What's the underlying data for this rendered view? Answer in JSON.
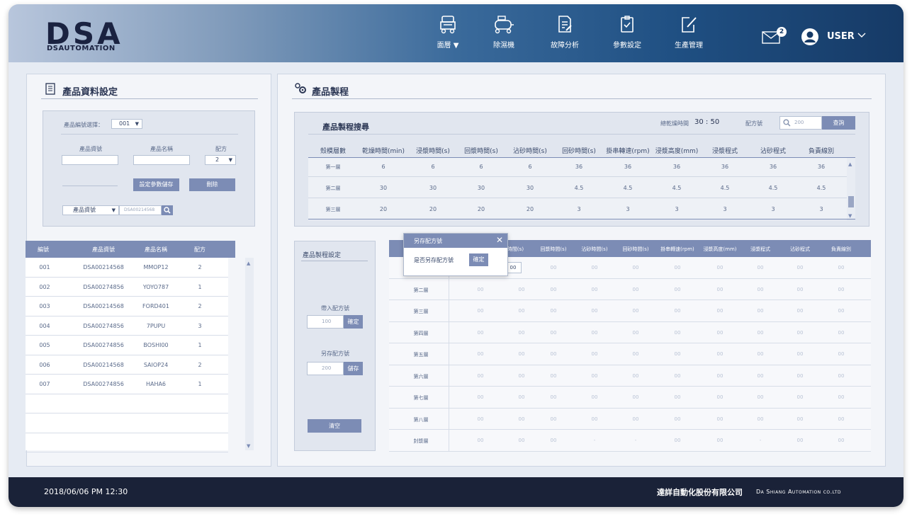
{
  "header": {
    "logo_text": "DSA",
    "logo_sub": "DSAUTOMATION",
    "nav": [
      {
        "label": "面層 ▼",
        "icon": "machine-icon"
      },
      {
        "label": "除濕機",
        "icon": "dehumidifier-icon"
      },
      {
        "label": "故障分析",
        "icon": "document-edit-icon"
      },
      {
        "label": "參數設定",
        "icon": "clipboard-check-icon"
      },
      {
        "label": "生產管理",
        "icon": "pencil-square-icon"
      }
    ],
    "mail_badge": "2",
    "user_label": "USER"
  },
  "left_panel": {
    "title": "產品資料設定",
    "product_select_label": "產品編號選擇：",
    "product_select_value": "001",
    "fields": {
      "material_label": "產品資號",
      "name_label": "產品名稱",
      "recipe_label": "配方",
      "recipe_value": "2"
    },
    "save_button": "設定參數儲存",
    "delete_button": "刪除",
    "search_select": "產品資號",
    "search_placeholder": "DSA00214568",
    "table": {
      "headers": [
        "編號",
        "產品資號",
        "產品名稱",
        "配方"
      ],
      "rows": [
        [
          "001",
          "DSA00214568",
          "MMOP12",
          "2"
        ],
        [
          "002",
          "DSA00274856",
          "YOYO787",
          "1"
        ],
        [
          "003",
          "DSA00214568",
          "FORD401",
          "2"
        ],
        [
          "004",
          "DSA00274856",
          "7PUPU",
          "3"
        ],
        [
          "005",
          "DSA00274856",
          "BOSHI00",
          "1"
        ],
        [
          "006",
          "DSA00214568",
          "SAIOP24",
          "2"
        ],
        [
          "007",
          "DSA00274856",
          "HAHA6",
          "1"
        ]
      ]
    }
  },
  "right_panel": {
    "title": "產品製程",
    "search": {
      "title": "產品製程搜尋",
      "total_time_label": "總乾燥時間",
      "total_time_value": "30 : 50",
      "recipe_label": "配方號",
      "recipe_placeholder": "200",
      "query_button": "查詢",
      "headers": [
        "殼模層數",
        "乾燥時間(min)",
        "浸漿時間(s)",
        "回漿時間(s)",
        "沾砂時間(s)",
        "回砂時間(s)",
        "掛串轉速(rpm)",
        "浸漿高度(mm)",
        "浸漿程式",
        "沾砂程式",
        "負責線別"
      ],
      "rows": [
        [
          "第一層",
          "6",
          "6",
          "6",
          "6",
          "36",
          "36",
          "36",
          "36",
          "36",
          "36"
        ],
        [
          "第二層",
          "30",
          "30",
          "30",
          "30",
          "4.5",
          "4.5",
          "4.5",
          "4.5",
          "4.5",
          "4.5"
        ],
        [
          "第三層",
          "20",
          "20",
          "20",
          "20",
          "3",
          "3",
          "3",
          "3",
          "3",
          "3"
        ]
      ]
    },
    "settings": {
      "title": "產品製程設定",
      "load_label": "帶入配方號",
      "load_value": "100",
      "load_button": "確定",
      "save_label": "另存配方號",
      "save_value": "200",
      "save_button": "儲存",
      "clear_button": "清空"
    },
    "grid": {
      "headers": [
        "",
        "",
        "燥時間(s)",
        "回漿時間(s)",
        "沾砂時間(s)",
        "回砂時間(s)",
        "掛串轉速(rpm)",
        "浸漿高度(mm)",
        "浸漿程式",
        "沾砂程式",
        "負責線別"
      ],
      "first_row_value": "00",
      "rows": [
        {
          "label": "",
          "vals": [
            "00",
            "00",
            "00",
            "00",
            "00",
            "00",
            "00",
            "00",
            "00"
          ]
        },
        {
          "label": "第二層",
          "vals": [
            "00",
            "00",
            "00",
            "00",
            "00",
            "00",
            "00",
            "00",
            "00",
            "00"
          ]
        },
        {
          "label": "第三層",
          "vals": [
            "00",
            "00",
            "00",
            "00",
            "00",
            "00",
            "00",
            "00",
            "00",
            "00"
          ]
        },
        {
          "label": "第四層",
          "vals": [
            "00",
            "00",
            "00",
            "00",
            "00",
            "00",
            "00",
            "00",
            "00",
            "00"
          ]
        },
        {
          "label": "第五層",
          "vals": [
            "00",
            "00",
            "00",
            "00",
            "00",
            "00",
            "00",
            "00",
            "00",
            "00"
          ]
        },
        {
          "label": "第六層",
          "vals": [
            "00",
            "00",
            "00",
            "00",
            "00",
            "00",
            "00",
            "00",
            "00",
            "00"
          ]
        },
        {
          "label": "第七層",
          "vals": [
            "00",
            "00",
            "00",
            "00",
            "00",
            "00",
            "00",
            "00",
            "00",
            "00"
          ]
        },
        {
          "label": "第八層",
          "vals": [
            "00",
            "00",
            "00",
            "00",
            "00",
            "00",
            "00",
            "00",
            "00",
            "00"
          ]
        },
        {
          "label": "封漿層",
          "vals": [
            "00",
            "00",
            "00",
            "-",
            "-",
            "00",
            "00",
            "-",
            "00",
            "00"
          ]
        }
      ]
    },
    "popup": {
      "title": "另存配方號",
      "message": "是否另存配方號",
      "confirm_button": "確定"
    }
  },
  "footer": {
    "datetime": "2018/06/06   PM 12:30",
    "company_cn": "達詳自動化股份有限公司",
    "company_en": "Da Shiang Automation co.ltd"
  },
  "colors": {
    "accent": "#7c8cb5",
    "header_dark": "#163a66",
    "footer": "#1a2238"
  }
}
